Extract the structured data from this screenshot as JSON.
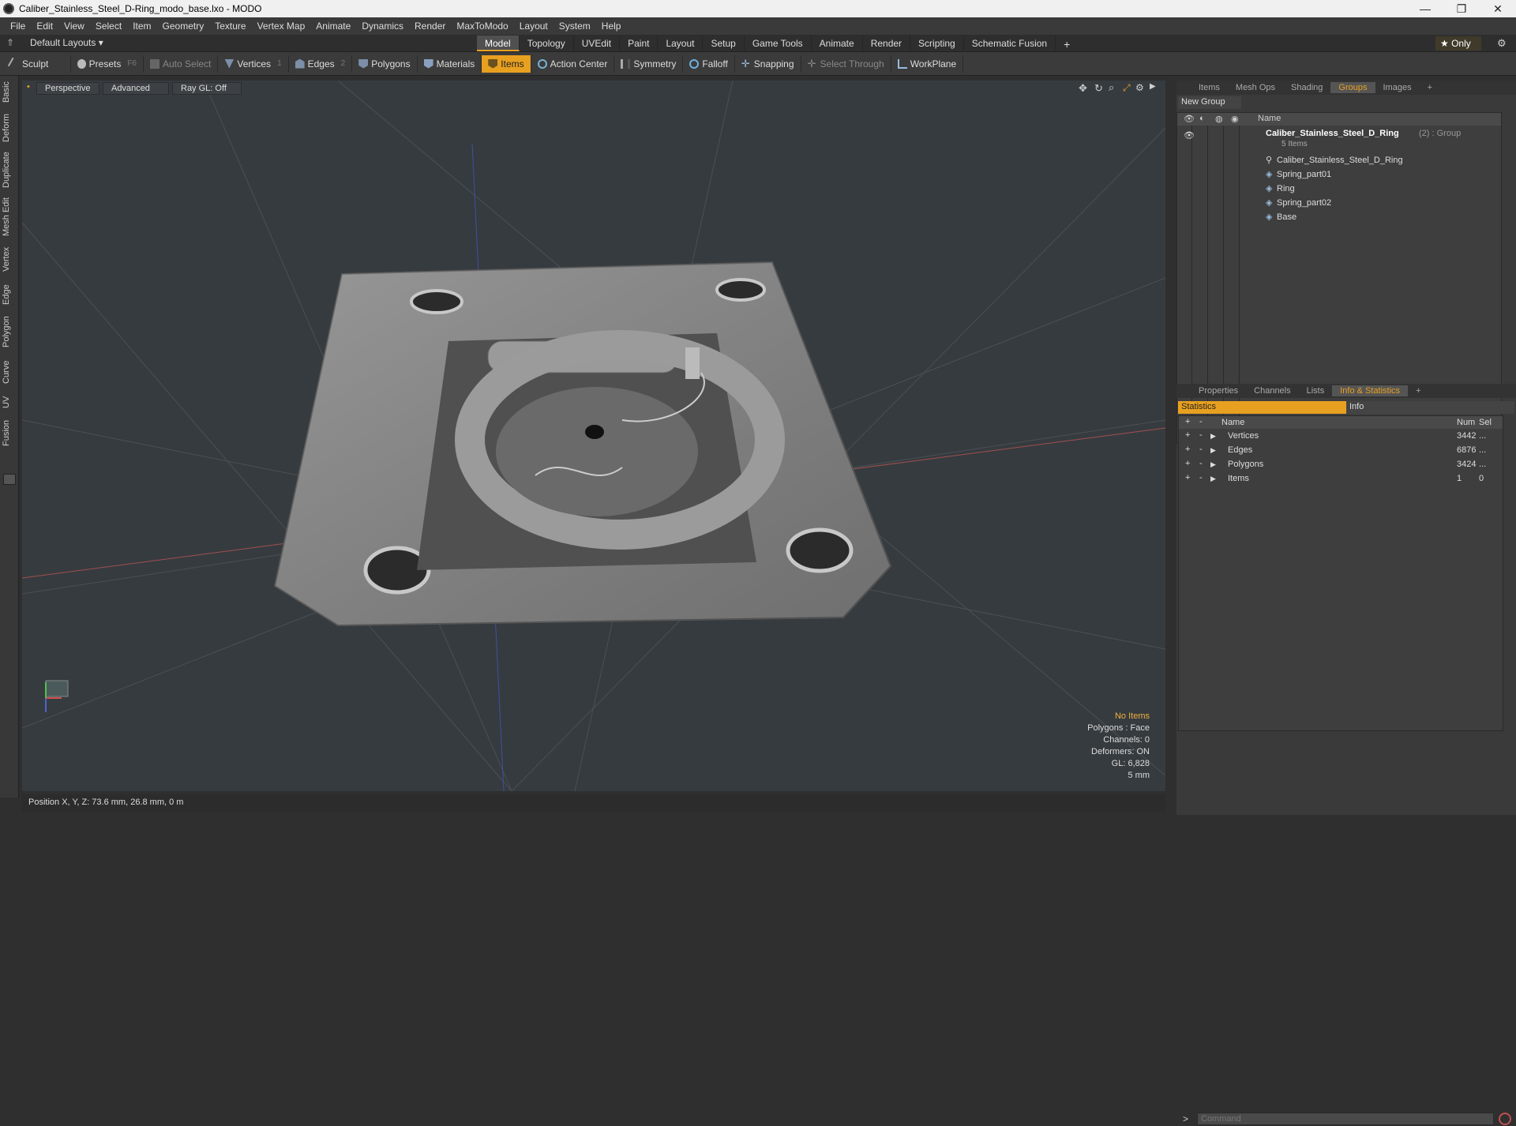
{
  "window": {
    "title": "Caliber_Stainless_Steel_D-Ring_modo_base.lxo - MODO",
    "minimize": "—",
    "maximize": "❐",
    "close": "✕"
  },
  "menu": [
    "File",
    "Edit",
    "View",
    "Select",
    "Item",
    "Geometry",
    "Texture",
    "Vertex Map",
    "Animate",
    "Dynamics",
    "Render",
    "MaxToModo",
    "Layout",
    "System",
    "Help"
  ],
  "layout": {
    "name": "Default Layouts ▾",
    "only_label": "★ Only",
    "tabs": [
      "Model",
      "Topology",
      "UVEdit",
      "Paint",
      "Layout",
      "Setup",
      "Game Tools",
      "Animate",
      "Render",
      "Scripting",
      "Schematic Fusion"
    ],
    "active_tab": "Model"
  },
  "toolbar": {
    "sculpt": "Sculpt",
    "presets": "Presets",
    "presets_key": "F6",
    "auto_select": "Auto Select",
    "vertices": "Vertices",
    "vertices_n": "1",
    "edges": "Edges",
    "edges_n": "2",
    "polygons": "Polygons",
    "materials": "Materials",
    "items": "Items",
    "action_center": "Action Center",
    "symmetry": "Symmetry",
    "falloff": "Falloff",
    "snapping": "Snapping",
    "select_through": "Select Through",
    "workplane": "WorkPlane"
  },
  "left_tabs": [
    "Basic",
    "Deform",
    "Duplicate",
    "Mesh Edit",
    "Vertex",
    "Edge",
    "Polygon",
    "Curve",
    "UV",
    "Fusion"
  ],
  "viewport": {
    "view": "Perspective",
    "shading": "Advanced",
    "raygl": "Ray GL: Off",
    "info": {
      "no_items": "No Items",
      "polygons": "Polygons : Face",
      "channels": "Channels: 0",
      "deformers": "Deformers: ON",
      "gl": "GL: 6,828",
      "scale": "5 mm"
    }
  },
  "status": {
    "position": "Position X, Y, Z:   73.6 mm, 26.8 mm, 0 m"
  },
  "groups_panel": {
    "tabs": [
      "Items",
      "Mesh Ops",
      "Shading",
      "Groups",
      "Images"
    ],
    "active": "Groups",
    "add": "+",
    "new_group": "New Group",
    "col_name": "Name",
    "root": {
      "name": "Caliber_Stainless_Steel_D_Ring",
      "suffix": "(2) : Group",
      "count": "5 Items"
    },
    "children": [
      "Caliber_Stainless_Steel_D_Ring",
      "Spring_part01",
      "Ring",
      "Spring_part02",
      "Base"
    ]
  },
  "info_panel": {
    "tabs": [
      "Properties",
      "Channels",
      "Lists",
      "Info & Statistics"
    ],
    "active": "Info & Statistics",
    "sub_left": "Statistics",
    "sub_right": "Info",
    "cols": {
      "name": "Name",
      "num": "Num",
      "sel": "Sel"
    },
    "rows": [
      {
        "name": "Vertices",
        "num": "3442",
        "sel": "..."
      },
      {
        "name": "Edges",
        "num": "6876",
        "sel": "..."
      },
      {
        "name": "Polygons",
        "num": "3424",
        "sel": "..."
      },
      {
        "name": "Items",
        "num": "1",
        "sel": "0"
      }
    ],
    "command_placeholder": "Command",
    "prompt": ">"
  },
  "colors": {
    "accent": "#e8a020",
    "viewport_bg": "#363b3f",
    "panel_bg": "#3a3a3a"
  }
}
